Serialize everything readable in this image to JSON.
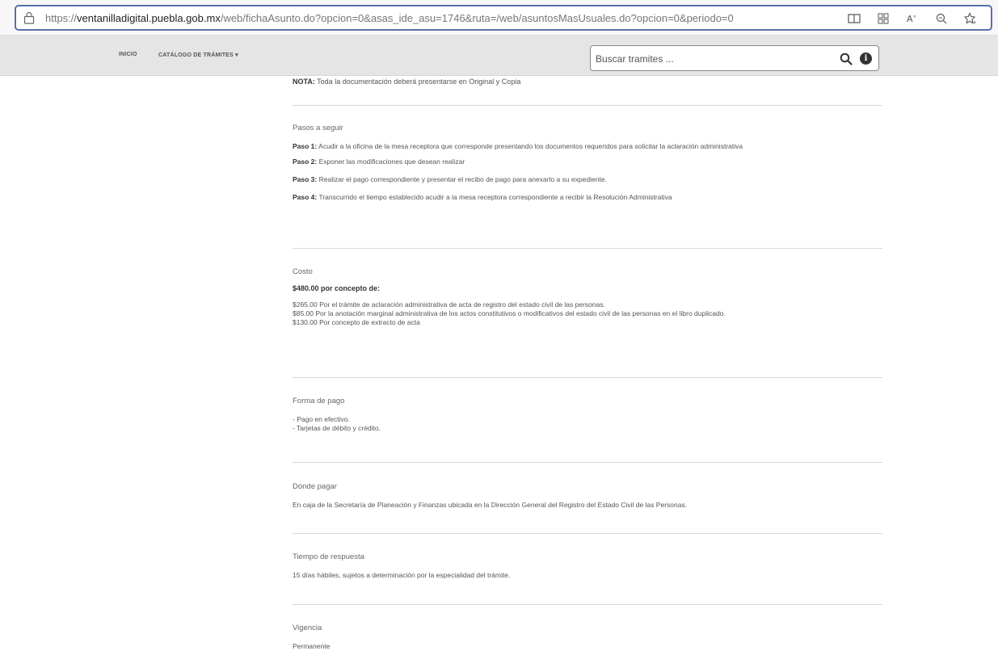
{
  "browser": {
    "url_prefix": "https://",
    "url_host": "ventanilladigital.puebla.gob.mx",
    "url_path": "/web/fichaAsunto.do?opcion=0&asas_ide_asu=1746&ruta=/web/asuntosMasUsuales.do?opcion=0&periodo=0",
    "icons": [
      "lock-icon",
      "reader-view-icon",
      "apps-icon",
      "read-aloud-icon",
      "zoom-icon",
      "favorites-icon"
    ]
  },
  "nav": {
    "inicio": "INICIO",
    "catalogo": "CATÁLOGO DE TRÁMITES ▾",
    "search_placeholder": "Buscar tramites ...",
    "info": "i"
  },
  "note": {
    "label": "NOTA:",
    "text": "Toda la documentación deberá presentarse en Original y Copia"
  },
  "pasos": {
    "title": "Pasos a seguir",
    "steps": [
      {
        "label": "Paso 1:",
        "text": "Acudir a la oficina de la mesa receptora que corresponde presentando los documentos requeridos para solicitar la aclaración administrativa"
      },
      {
        "label": "Paso 2:",
        "text": "Exponer las modificaciones que desean realizar"
      },
      {
        "label": "Paso 3:",
        "text": "Realizar el pago correspondiente y presentar el recibo de pago para anexarlo a su expediente."
      },
      {
        "label": "Paso 4:",
        "text": "Transcurrido el tiempo establecido acudir a la mesa receptora correspondiente a recibir la Resolución Administrativa"
      }
    ]
  },
  "costo": {
    "title": "Costo",
    "heading": "$480.00 por concepto de:",
    "lines": [
      "$265.00  Por el trámite de aclaración administrativa de acta de registro del estado civil de las personas.",
      "$85.00   Por la anotación marginal administrativa de los actos constitutivos o modificativos del estado civil de las personas en el libro duplicado.",
      "$130.00  Por concepto de extracto de acta"
    ]
  },
  "forma_pago": {
    "title": "Forma de pago",
    "lines": [
      "- Pago en efectivo.",
      "- Tarjetas de débito y crédito."
    ]
  },
  "donde_pagar": {
    "title": "Dónde pagar",
    "text": "En caja de la Secretaría de Planeación y Finanzas ubicada en la Dirección General del Registro del Estado Civil de las Personas."
  },
  "tiempo": {
    "title": "Tiempo de respuesta",
    "text": "15 días hábiles, sujetos a determinación por la especialidad del trámite."
  },
  "vigencia": {
    "title": "Vigencia",
    "text": "Permanente"
  }
}
